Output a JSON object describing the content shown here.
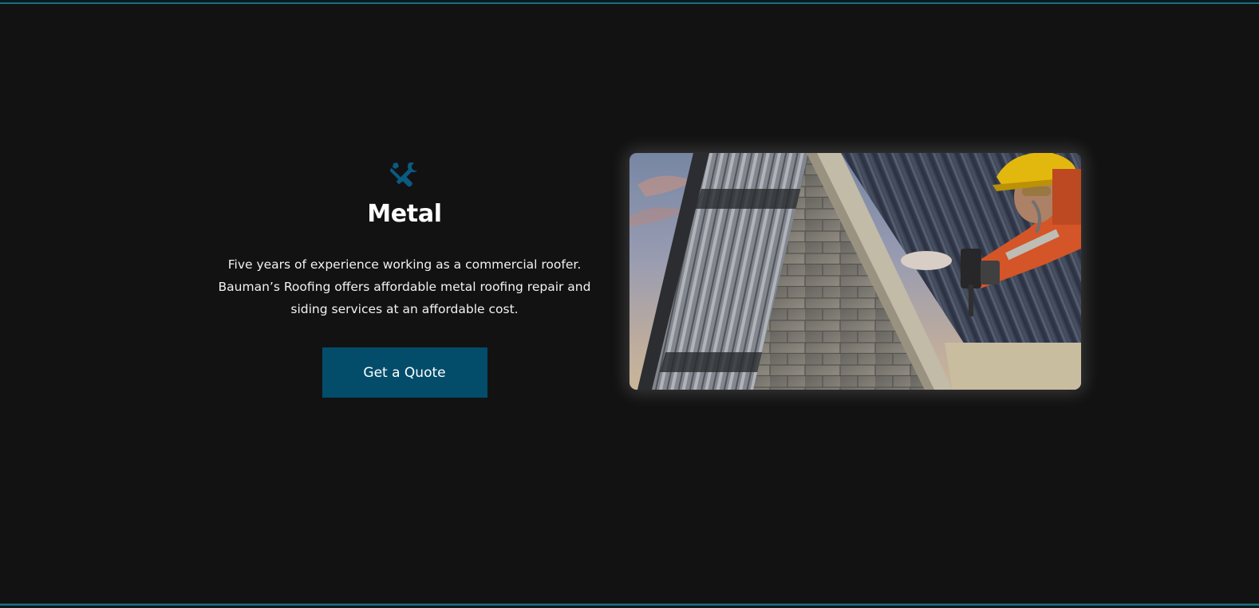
{
  "service": {
    "icon": "tools-icon",
    "title": "Metal",
    "description": "Five years of experience working as a commercial roofer. Bauman’s Roofing offers affordable metal roofing repair and siding services at an affordable cost.",
    "cta_label": "Get a Quote"
  },
  "colors": {
    "background": "#121212",
    "accent": "#034d6b",
    "icon": "#0b5a80",
    "border_line": "#1d6f80",
    "text": "#ffffff"
  },
  "photo": {
    "subject": "roofer-installing-metal-roof-photo"
  }
}
